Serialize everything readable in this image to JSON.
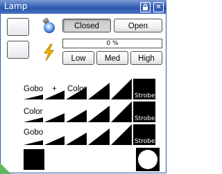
{
  "window": {
    "title": "Lamp"
  },
  "shutter": {
    "closed_label": "Closed",
    "open_label": "Open",
    "selected": "Closed"
  },
  "intensity": {
    "progress_text": "0 %",
    "progress_value": 0
  },
  "power": {
    "low_label": "Low",
    "med_label": "Med",
    "high_label": "High"
  },
  "rows": [
    {
      "label_left": "Gobo",
      "label_mid": "+",
      "label_right": "Color",
      "strobe_label": "Strobe"
    },
    {
      "label_left": "Color",
      "strobe_label": "Strobe"
    },
    {
      "label_left": "Gobo",
      "strobe_label": "Strobe"
    }
  ],
  "icons": {
    "lamp": "bulb-icon",
    "power": "lightning-icon",
    "lock": "lock-icon",
    "close": "close-icon"
  }
}
